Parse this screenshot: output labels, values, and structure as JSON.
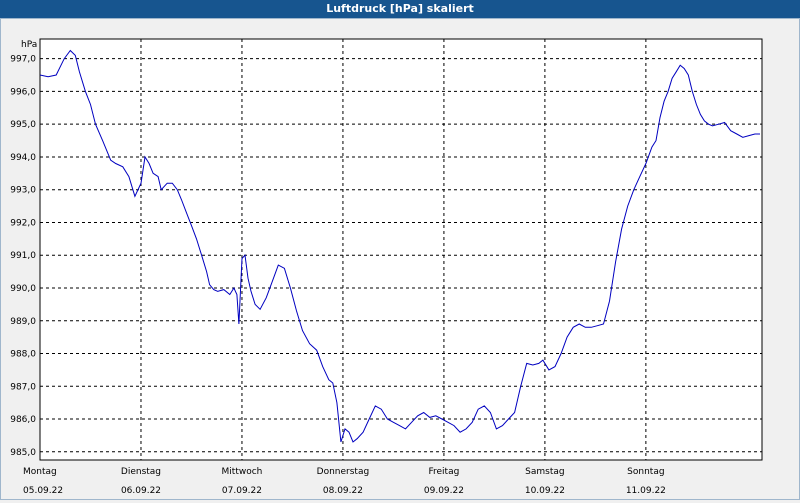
{
  "window": {
    "title": "Luftdruck [hPa] skaliert"
  },
  "colors": {
    "titlebar": "#17558f",
    "line": "#0000c0",
    "grid": "#000000",
    "plot_bg": "#ffffff",
    "panel_bg": "#f0f0f0"
  },
  "chart_data": {
    "type": "line",
    "title": "Luftdruck [hPa] skaliert",
    "ylabel": "hPa",
    "xlabel": "",
    "ylim": [
      984.75,
      997.6
    ],
    "xlim": [
      0,
      7.15
    ],
    "grid": true,
    "y_ticks": [
      "997,0",
      "996,0",
      "995,0",
      "994,0",
      "993,0",
      "992,0",
      "991,0",
      "990,0",
      "989,0",
      "988,0",
      "987,0",
      "986,0",
      "985,0"
    ],
    "y_tick_values": [
      997,
      996,
      995,
      994,
      993,
      992,
      991,
      990,
      989,
      988,
      987,
      986,
      985
    ],
    "x_ticks": [
      {
        "day": "Montag",
        "date": "05.09.22"
      },
      {
        "day": "Dienstag",
        "date": "06.09.22"
      },
      {
        "day": "Mittwoch",
        "date": "07.09.22"
      },
      {
        "day": "Donnerstag",
        "date": "08.09.22"
      },
      {
        "day": "Freitag",
        "date": "09.09.22"
      },
      {
        "day": "Samstag",
        "date": "10.09.22"
      },
      {
        "day": "Sonntag",
        "date": "11.09.22"
      }
    ],
    "series": [
      {
        "x": [
          0,
          0.08,
          0.16,
          0.24,
          0.3,
          0.35,
          0.39,
          0.45,
          0.5,
          0.55,
          0.62,
          0.7,
          0.75,
          0.82,
          0.88,
          0.94,
          1.0,
          1.04,
          1.08,
          1.12,
          1.17,
          1.2,
          1.26,
          1.31,
          1.36,
          1.4,
          1.45,
          1.5,
          1.55,
          1.6,
          1.65,
          1.68,
          1.72,
          1.76,
          1.82,
          1.88,
          1.92,
          1.95,
          1.97,
          2.0,
          2.03,
          2.06,
          2.09,
          2.13,
          2.18,
          2.24,
          2.3,
          2.36,
          2.42,
          2.48,
          2.54,
          2.6,
          2.67,
          2.74,
          2.8,
          2.86,
          2.9,
          2.94,
          2.98,
          3.02,
          3.06,
          3.1,
          3.14,
          3.2,
          3.26,
          3.32,
          3.38,
          3.44,
          3.5,
          3.56,
          3.62,
          3.68,
          3.74,
          3.8,
          3.86,
          3.92,
          3.98,
          4.04,
          4.1,
          4.16,
          4.22,
          4.28,
          4.34,
          4.4,
          4.46,
          4.52,
          4.58,
          4.64,
          4.7,
          4.76,
          4.82,
          4.88,
          4.94,
          4.98,
          5.04,
          5.1,
          5.16,
          5.22,
          5.28,
          5.34,
          5.4,
          5.46,
          5.52,
          5.58,
          5.64,
          5.7,
          5.76,
          5.82,
          5.88,
          5.94,
          6.0,
          6.06,
          6.1,
          6.14,
          6.18,
          6.22,
          6.26,
          6.3,
          6.34,
          6.38,
          6.42,
          6.46,
          6.5,
          6.54,
          6.58,
          6.62,
          6.66,
          6.72,
          6.78,
          6.84,
          6.9,
          6.96,
          7.02,
          7.08,
          7.13
        ],
        "y": [
          996.5,
          996.45,
          996.5,
          997.0,
          997.25,
          997.1,
          996.6,
          996.0,
          995.6,
          995.0,
          994.5,
          993.9,
          993.8,
          993.7,
          993.4,
          992.8,
          993.2,
          994.0,
          993.8,
          993.5,
          993.4,
          993.0,
          993.2,
          993.2,
          993.0,
          992.7,
          992.3,
          991.9,
          991.5,
          991.0,
          990.5,
          990.1,
          989.95,
          989.9,
          989.95,
          989.8,
          990.0,
          989.8,
          988.9,
          990.9,
          991.0,
          990.3,
          989.9,
          989.5,
          989.35,
          989.7,
          990.2,
          990.7,
          990.6,
          990.0,
          989.3,
          988.7,
          988.3,
          988.1,
          987.6,
          987.2,
          987.1,
          986.5,
          985.3,
          985.7,
          985.6,
          985.3,
          985.4,
          985.6,
          986.0,
          986.4,
          986.3,
          986.0,
          985.9,
          985.8,
          985.7,
          985.9,
          986.1,
          986.2,
          986.05,
          986.1,
          986.0,
          985.9,
          985.8,
          985.6,
          985.7,
          985.9,
          986.3,
          986.4,
          986.2,
          985.7,
          985.8,
          986.0,
          986.2,
          987.0,
          987.7,
          987.65,
          987.7,
          987.8,
          987.5,
          987.6,
          988.0,
          988.5,
          988.8,
          988.9,
          988.8,
          988.8,
          988.85,
          988.9,
          989.6,
          990.8,
          991.8,
          992.5,
          993.0,
          993.4,
          993.8,
          994.3,
          994.5,
          995.2,
          995.7,
          996.0,
          996.4,
          996.6,
          996.8,
          996.7,
          996.5,
          996.0,
          995.6,
          995.3,
          995.1,
          995.0,
          994.95,
          995.0,
          995.05,
          994.8,
          994.7,
          994.6,
          994.65,
          994.7,
          994.7
        ]
      }
    ]
  }
}
